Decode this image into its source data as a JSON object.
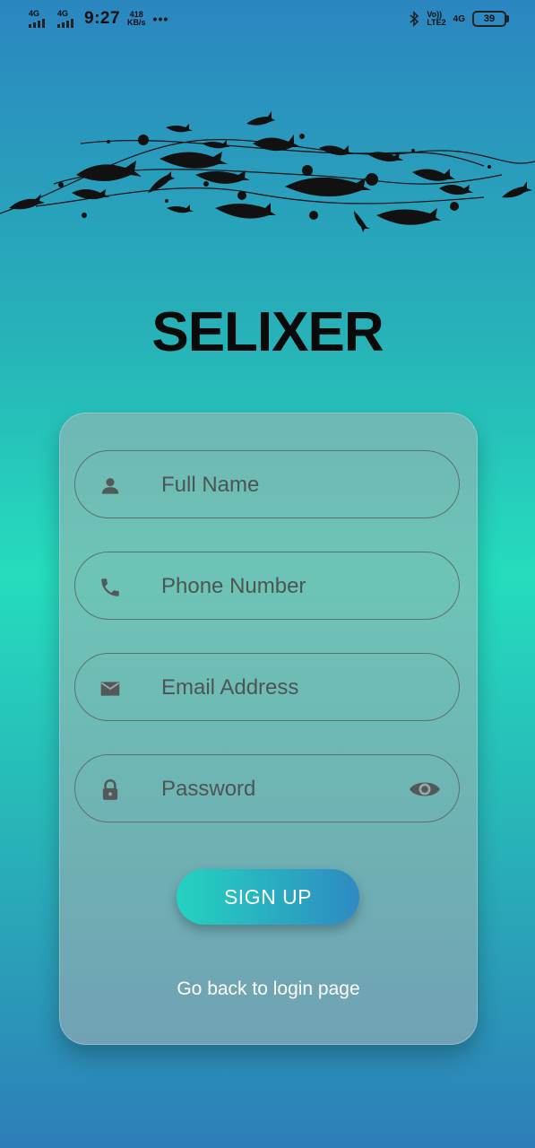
{
  "status_bar": {
    "sim1_net": "4G",
    "sim2_net": "4G",
    "time": "9:27",
    "speed_value": "418",
    "speed_unit": "KB/s",
    "more": "•••",
    "volte_line1": "Vo))",
    "volte_line2": "LTE2",
    "net_right": "4G",
    "battery": "39"
  },
  "app": {
    "title": "SELIXER"
  },
  "form": {
    "full_name_placeholder": "Full Name",
    "phone_placeholder": "Phone Number",
    "email_placeholder": "Email Address",
    "password_placeholder": "Password",
    "signup_label": "SIGN UP",
    "login_link": "Go back to login page"
  },
  "icons": {
    "full_name": "person-icon",
    "phone": "phone-icon",
    "email": "mail-icon",
    "password": "lock-icon",
    "toggle": "eye-icon"
  },
  "colors": {
    "gradient_top": "#2b86c0",
    "gradient_mid": "#25dcbd",
    "gradient_bottom": "#2d7eb8",
    "button_start": "#24d3c0",
    "button_end": "#2e8ac2"
  }
}
